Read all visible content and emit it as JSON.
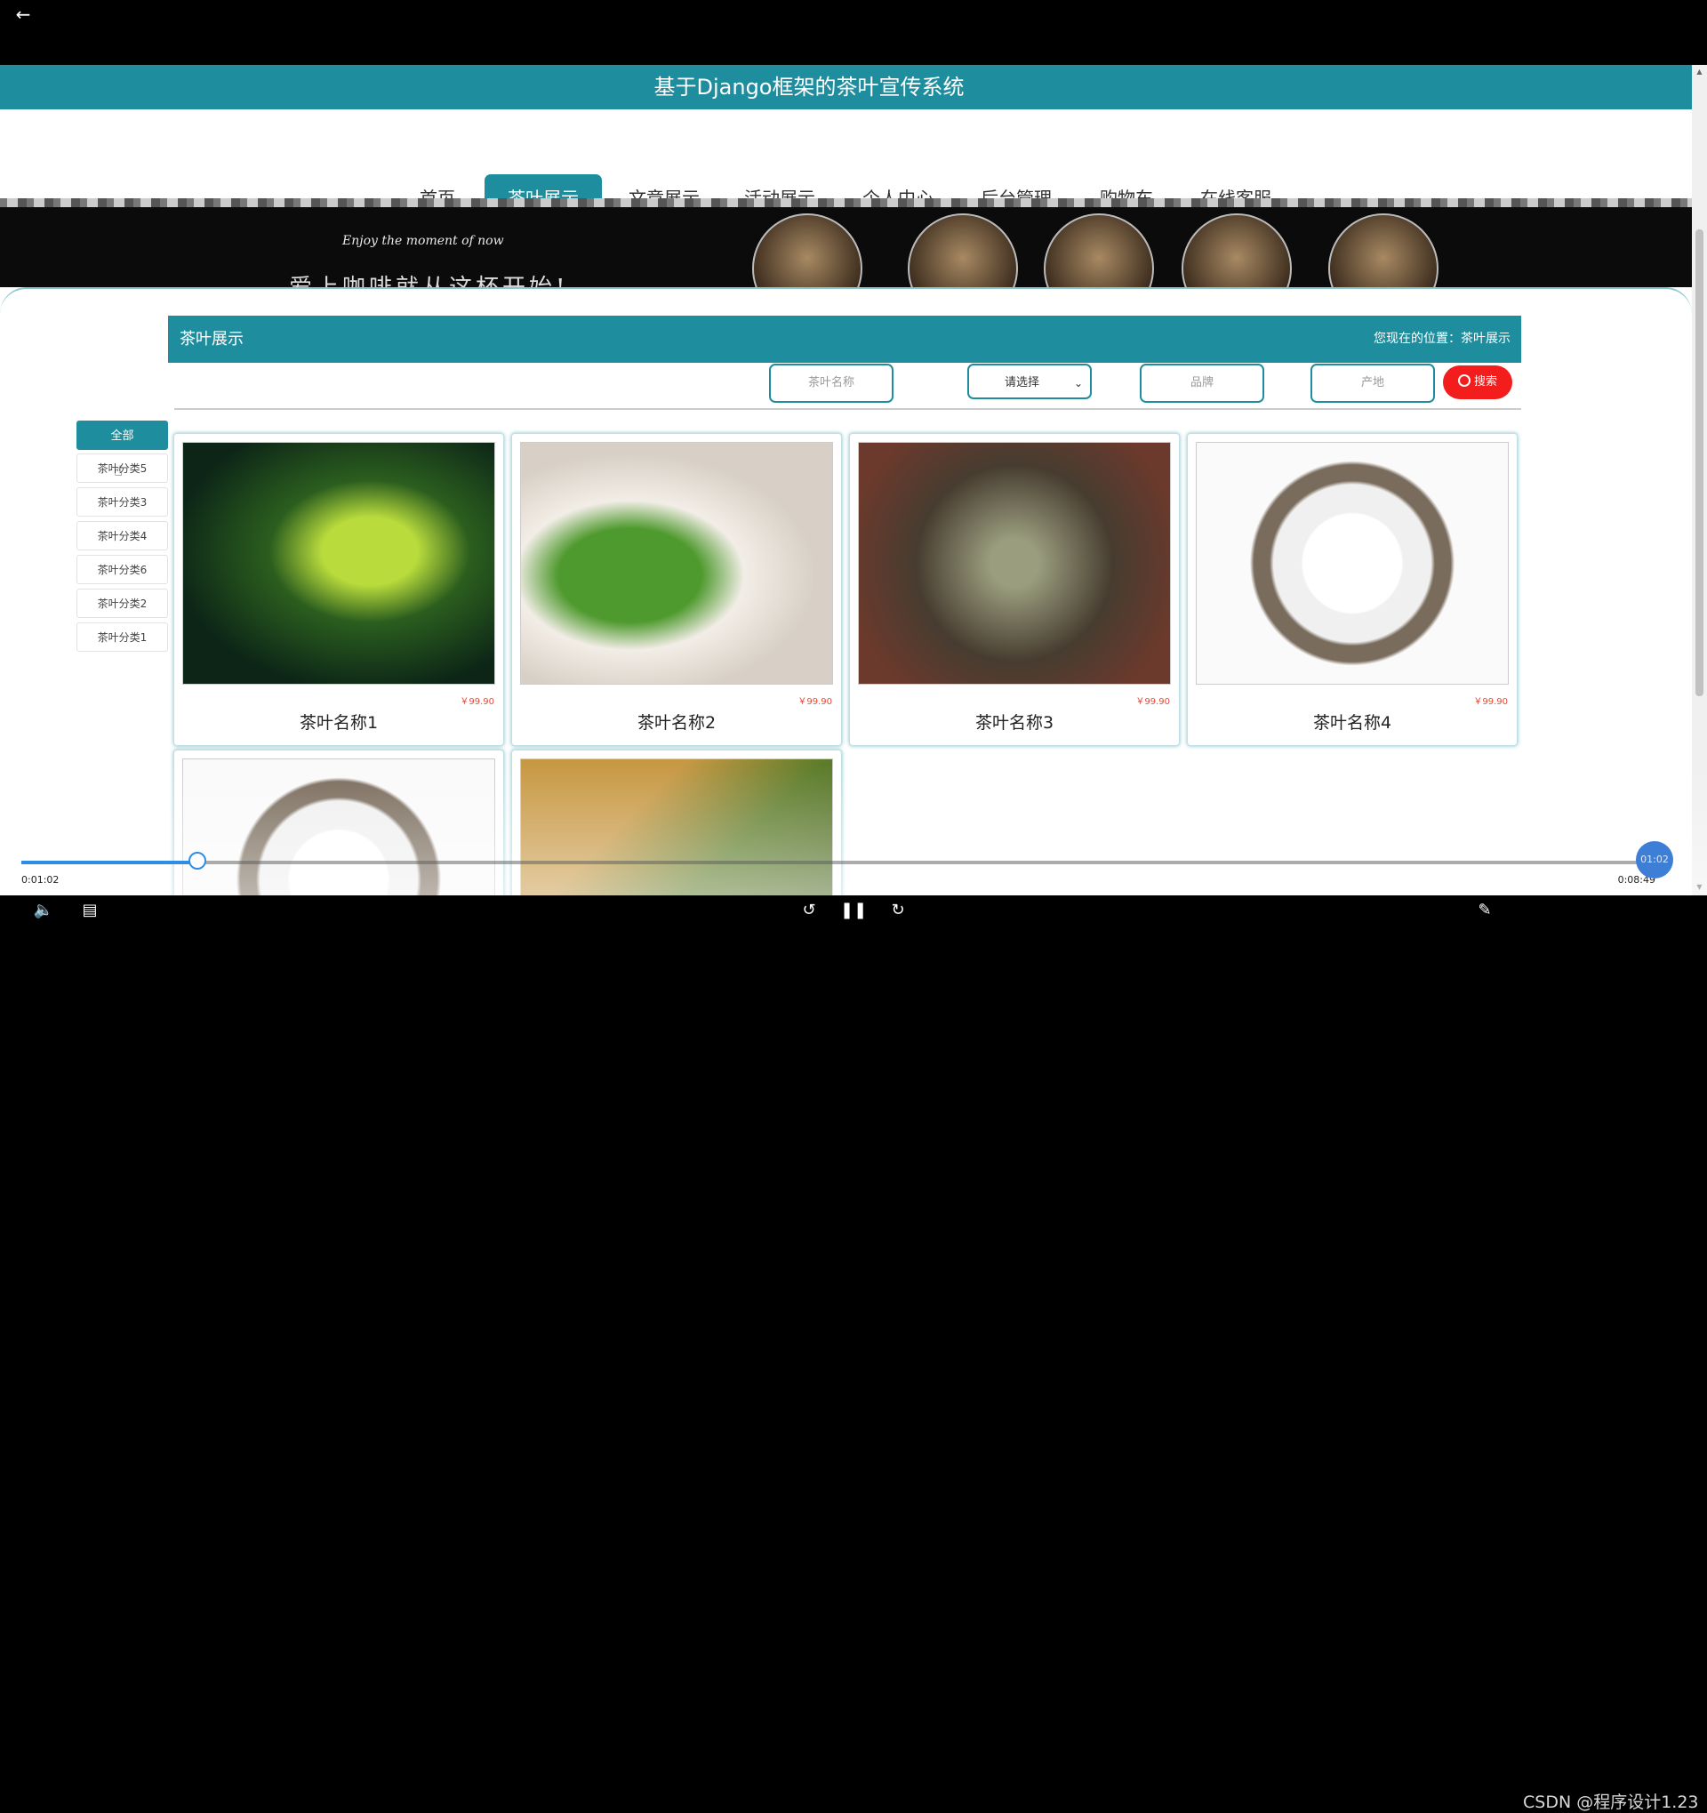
{
  "player": {
    "back_icon": "←",
    "current_time": "0:01:02",
    "total_time": "0:08:49",
    "time_bubble": "01:02",
    "progress_fraction": 0.108,
    "watermark": "CSDN @程序设计1.23"
  },
  "site": {
    "title": "基于Django框架的茶叶宣传系统",
    "nav": [
      "首页",
      "茶叶展示",
      "文章展示",
      "活动展示",
      "个人中心",
      "后台管理",
      "购物车",
      "在线客服"
    ],
    "active_nav": "茶叶展示",
    "banner_text": "Enjoy the moment of now",
    "banner_text_cn": "爱上咖啡就从这杯开始!"
  },
  "section": {
    "title": "茶叶展示",
    "position": "您现在的位置：茶叶展示"
  },
  "search": {
    "name_placeholder": "茶叶名称",
    "select_value": "请选择",
    "brand_placeholder": "品牌",
    "origin_placeholder": "产地",
    "button_label": "搜索"
  },
  "categories": [
    "全部",
    "茶叶分类5",
    "茶叶分类3",
    "茶叶分类4",
    "茶叶分类6",
    "茶叶分类2",
    "茶叶分类1"
  ],
  "products": [
    {
      "name": "茶叶名称1",
      "price": "￥99.90"
    },
    {
      "name": "茶叶名称2",
      "price": "￥99.90"
    },
    {
      "name": "茶叶名称3",
      "price": "￥99.90"
    },
    {
      "name": "茶叶名称4",
      "price": "￥99.90"
    },
    {
      "name": "",
      "price": ""
    },
    {
      "name": "",
      "price": ""
    }
  ],
  "colors": {
    "accent": "#1e8e9e",
    "search_button": "#f31d1d",
    "price": "#e24a3a",
    "progress": "#2d8ee6"
  }
}
